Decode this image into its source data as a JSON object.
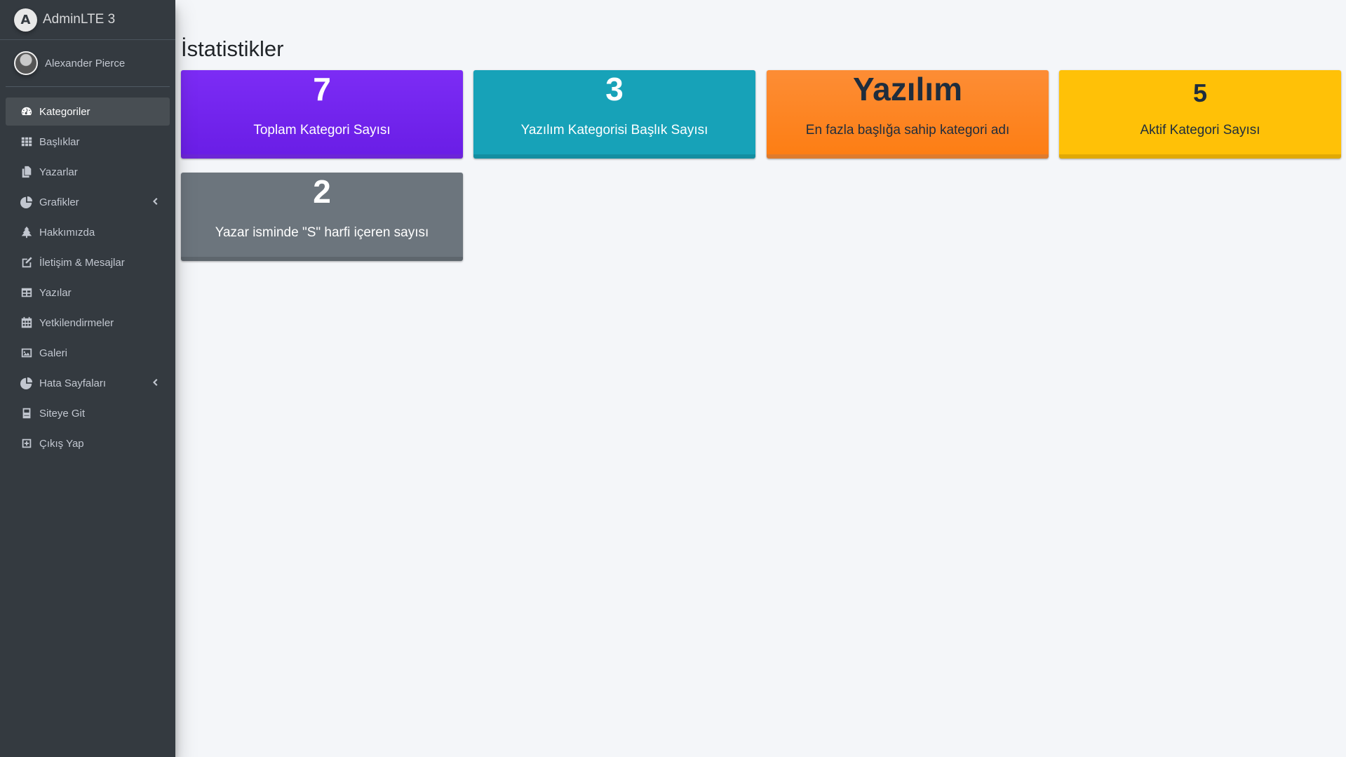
{
  "brand": {
    "name": "AdminLTE 3",
    "logo_letter": "A"
  },
  "user": {
    "name": "Alexander Pierce"
  },
  "sidebar": {
    "items": [
      {
        "label": "Kategoriler",
        "icon": "tachometer-icon",
        "active": true
      },
      {
        "label": "Başlıklar",
        "icon": "grid-icon"
      },
      {
        "label": "Yazarlar",
        "icon": "copy-icon"
      },
      {
        "label": "Grafikler",
        "icon": "pie-chart-icon",
        "has_children": true
      },
      {
        "label": "Hakkımızda",
        "icon": "tree-icon"
      },
      {
        "label": "İletişim & Mesajlar",
        "icon": "edit-icon"
      },
      {
        "label": "Yazılar",
        "icon": "table-icon"
      },
      {
        "label": "Yetkilendirmeler",
        "icon": "calendar-icon"
      },
      {
        "label": "Galeri",
        "icon": "image-icon"
      },
      {
        "label": "Hata Sayfaları",
        "icon": "pie-chart-icon",
        "has_children": true
      },
      {
        "label": "Siteye Git",
        "icon": "book-icon"
      },
      {
        "label": "Çıkış Yap",
        "icon": "plus-square-icon"
      }
    ]
  },
  "main": {
    "title": "İstatistikler",
    "stats": [
      {
        "value": "7",
        "label": "Toplam Kategori Sayısı",
        "color": "#6f22ee"
      },
      {
        "value": "3",
        "label": "Yazılım Kategorisi Başlık Sayısı",
        "color": "#17a2b8"
      },
      {
        "value": "Yazılım",
        "label": "En fazla başlığa sahip kategori adı",
        "color": "#fd7e14"
      },
      {
        "value": "5",
        "label": "Aktif Kategori Sayısı",
        "color": "#ffc107"
      },
      {
        "value": "2",
        "label": "Yazar isminde \"S\" harfi içeren sayısı",
        "color": "#6c757d"
      }
    ]
  }
}
